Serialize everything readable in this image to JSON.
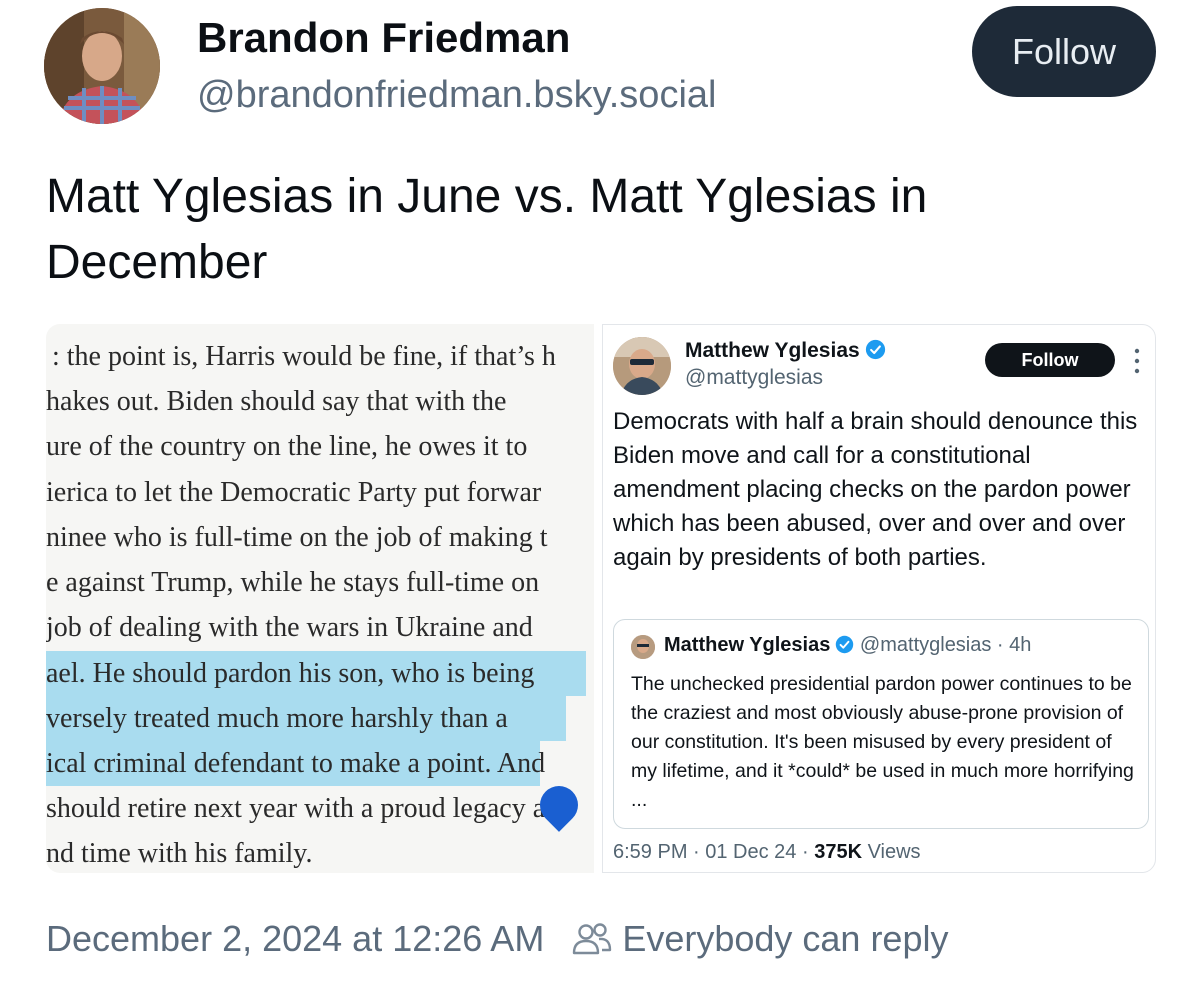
{
  "author": {
    "display_name": "Brandon Friedman",
    "handle": "@brandonfriedman.bsky.social",
    "follow_label": "Follow"
  },
  "post": {
    "text": "Matt Yglesias in June vs. Matt Yglesias in December",
    "timestamp": "December 2, 2024 at 12:26 AM",
    "reply_setting": "Everybody can reply"
  },
  "excerpt_image": {
    "lines": [
      ": the point is, Harris would be fine, if that’s h",
      "hakes out. Biden should say that with the",
      "ure of the country on the line, he owes it to",
      "ierica to let the Democratic Party put forwar",
      "ninee who is full-time on the job of making t",
      "e against Trump, while he stays full-time on",
      " job of dealing with the wars in Ukraine and",
      "ael. He should pardon his son, who is being",
      "versely treated much more harshly than a",
      "ical criminal defendant to make a point. And",
      "should retire next year with a proud legacy a",
      "nd time with his family."
    ],
    "highlight_color": "#a9dcef"
  },
  "tweet_image": {
    "name": "Matthew Yglesias",
    "handle": "@mattyglesias",
    "follow_label": "Follow",
    "body": "Democrats with half a brain should denounce this Biden move and call for a constitutional amendment placing checks on the pardon power which has been abused, over and over and over again by presidents of both parties.",
    "quote": {
      "name": "Matthew Yglesias",
      "handle_time": "@mattyglesias · 4h",
      "body": "The unchecked presidential pardon power continues to be the craziest and most obviously abuse-prone provision of our constitution. It's been misused by every president of my lifetime, and it *could* be used in much more horrifying ..."
    },
    "meta_time": "6:59 PM · 01 Dec 24 · ",
    "views_count": "375K",
    "views_label": " Views",
    "verified_color": "#1d9bf0"
  },
  "icons": {
    "people": "people-icon",
    "verified": "verified-badge-icon",
    "more": "more-vertical-icon"
  }
}
